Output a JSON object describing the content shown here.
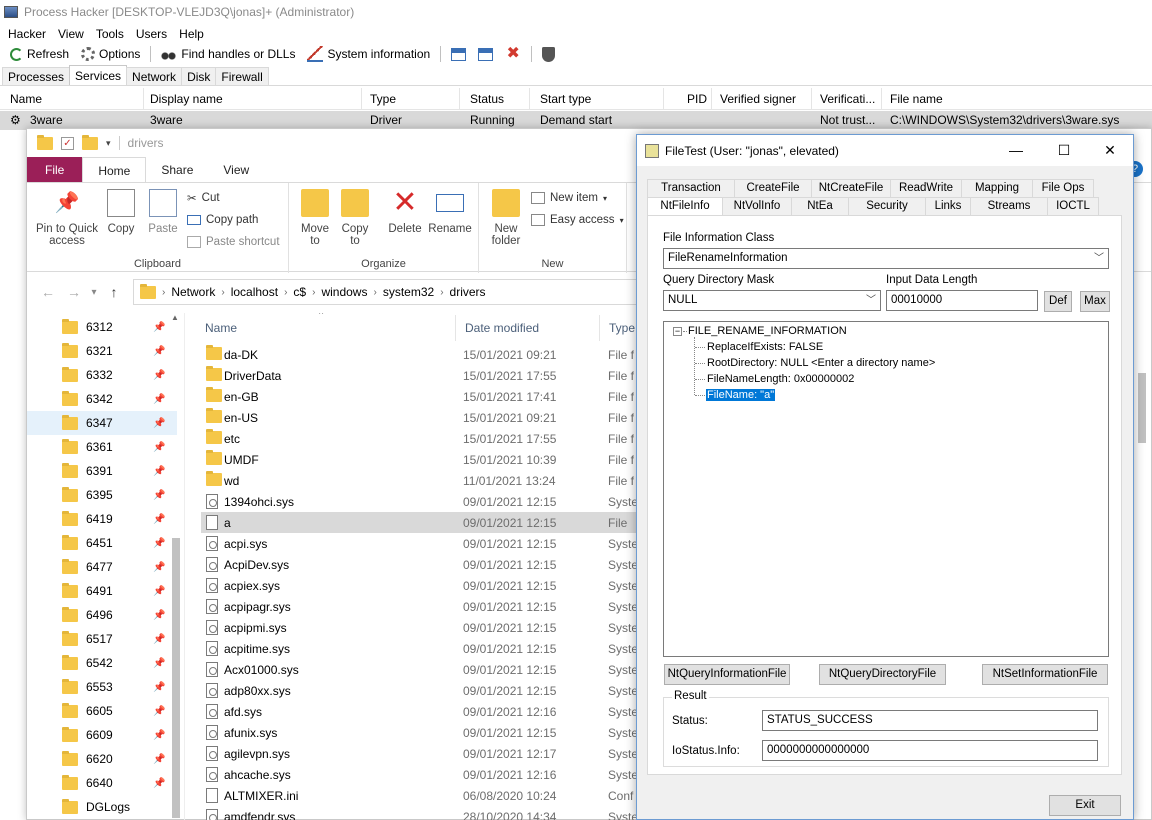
{
  "ph": {
    "title": "Process Hacker [DESKTOP-VLEJD3Q\\jonas]+ (Administrator)",
    "menu": [
      "Hacker",
      "View",
      "Tools",
      "Users",
      "Help"
    ],
    "toolbar": {
      "refresh": "Refresh",
      "options": "Options",
      "find": "Find handles or DLLs",
      "sysinfo": "System information"
    },
    "tabs": [
      "Processes",
      "Services",
      "Network",
      "Disk",
      "Firewall"
    ],
    "columns": [
      "Name",
      "Display name",
      "Type",
      "Status",
      "Start type",
      "PID",
      "Verified signer",
      "Verificati...",
      "File name"
    ],
    "row": {
      "name": "3ware",
      "display": "3ware",
      "type": "Driver",
      "status": "Running",
      "start": "Demand start",
      "pid": "",
      "signer": "",
      "verif": "Not trust...",
      "file": "C:\\WINDOWS\\System32\\drivers\\3ware.sys"
    }
  },
  "ex": {
    "qat_title": "drivers",
    "tabs": {
      "file": "File",
      "home": "Home",
      "share": "Share",
      "view": "View"
    },
    "ribbon": {
      "pin": "Pin to Quick access",
      "copy": "Copy",
      "paste": "Paste",
      "cut": "Cut",
      "copy_path": "Copy path",
      "paste_shortcut": "Paste shortcut",
      "clipboard": "Clipboard",
      "move_to": "Move to",
      "copy_to": "Copy to",
      "delete": "Delete",
      "rename": "Rename",
      "organize": "Organize",
      "new_folder": "New folder",
      "new_item": "New item",
      "easy_access": "Easy access",
      "new": "New"
    },
    "address": [
      "Network",
      "localhost",
      "c$",
      "windows",
      "system32",
      "drivers"
    ],
    "nav": [
      "6312",
      "6321",
      "6332",
      "6342",
      "6347",
      "6361",
      "6391",
      "6395",
      "6419",
      "6451",
      "6477",
      "6491",
      "6496",
      "6517",
      "6542",
      "6553",
      "6605",
      "6609",
      "6620",
      "6640",
      "DGLogs"
    ],
    "list_headers": {
      "name": "Name",
      "date": "Date modified",
      "type": "Type"
    },
    "files": [
      {
        "name": "da-DK",
        "date": "15/01/2021 09:21",
        "type": "File f",
        "kind": "folder"
      },
      {
        "name": "DriverData",
        "date": "15/01/2021 17:55",
        "type": "File f",
        "kind": "folder"
      },
      {
        "name": "en-GB",
        "date": "15/01/2021 17:41",
        "type": "File f",
        "kind": "folder"
      },
      {
        "name": "en-US",
        "date": "15/01/2021 09:21",
        "type": "File f",
        "kind": "folder"
      },
      {
        "name": "etc",
        "date": "15/01/2021 17:55",
        "type": "File f",
        "kind": "folder"
      },
      {
        "name": "UMDF",
        "date": "15/01/2021 10:39",
        "type": "File f",
        "kind": "folder"
      },
      {
        "name": "wd",
        "date": "11/01/2021 13:24",
        "type": "File f",
        "kind": "folder"
      },
      {
        "name": "1394ohci.sys",
        "date": "09/01/2021 12:15",
        "type": "Syste",
        "kind": "sys"
      },
      {
        "name": "a",
        "date": "09/01/2021 12:15",
        "type": "File",
        "kind": "file"
      },
      {
        "name": "acpi.sys",
        "date": "09/01/2021 12:15",
        "type": "Syste",
        "kind": "sys"
      },
      {
        "name": "AcpiDev.sys",
        "date": "09/01/2021 12:15",
        "type": "Syste",
        "kind": "sys"
      },
      {
        "name": "acpiex.sys",
        "date": "09/01/2021 12:15",
        "type": "Syste",
        "kind": "sys"
      },
      {
        "name": "acpipagr.sys",
        "date": "09/01/2021 12:15",
        "type": "Syste",
        "kind": "sys"
      },
      {
        "name": "acpipmi.sys",
        "date": "09/01/2021 12:15",
        "type": "Syste",
        "kind": "sys"
      },
      {
        "name": "acpitime.sys",
        "date": "09/01/2021 12:15",
        "type": "Syste",
        "kind": "sys"
      },
      {
        "name": "Acx01000.sys",
        "date": "09/01/2021 12:15",
        "type": "Syste",
        "kind": "sys"
      },
      {
        "name": "adp80xx.sys",
        "date": "09/01/2021 12:15",
        "type": "Syste",
        "kind": "sys"
      },
      {
        "name": "afd.sys",
        "date": "09/01/2021 12:16",
        "type": "Syste",
        "kind": "sys"
      },
      {
        "name": "afunix.sys",
        "date": "09/01/2021 12:15",
        "type": "Syste",
        "kind": "sys"
      },
      {
        "name": "agilevpn.sys",
        "date": "09/01/2021 12:17",
        "type": "Syste",
        "kind": "sys"
      },
      {
        "name": "ahcache.sys",
        "date": "09/01/2021 12:16",
        "type": "Syste",
        "kind": "sys"
      },
      {
        "name": "ALTMIXER.ini",
        "date": "06/08/2020 10:24",
        "type": "Conf",
        "kind": "file"
      },
      {
        "name": "amdfendr.sys",
        "date": "28/10/2020 14:34",
        "type": "Syste",
        "kind": "sys"
      }
    ]
  },
  "ft": {
    "title": "FileTest (User: \"jonas\", elevated)",
    "tabs_row1": [
      "Transaction",
      "CreateFile",
      "NtCreateFile",
      "ReadWrite",
      "Mapping",
      "File Ops"
    ],
    "tabs_row2": [
      "NtFileInfo",
      "NtVolInfo",
      "NtEa",
      "Security",
      "Links",
      "Streams",
      "IOCTL"
    ],
    "class_label": "File Information Class",
    "class_value": "FileRenameInformation",
    "mask_label": "Query Directory Mask",
    "mask_value": "NULL",
    "len_label": "Input Data Length",
    "len_value": "00010000",
    "def": "Def",
    "max": "Max",
    "tree": {
      "root": "FILE_RENAME_INFORMATION",
      "children": [
        "ReplaceIfExists: FALSE",
        "RootDirectory: NULL <Enter a directory name>",
        "FileNameLength: 0x00000002",
        "FileName: \"a\""
      ]
    },
    "btn_query": "NtQueryInformationFile",
    "btn_querydir": "NtQueryDirectoryFile",
    "btn_set": "NtSetInformationFile",
    "result_label": "Result",
    "status_label": "Status:",
    "status_value": "STATUS_SUCCESS",
    "info_label": "IoStatus.Info:",
    "info_value": "0000000000000000",
    "exit": "Exit"
  }
}
